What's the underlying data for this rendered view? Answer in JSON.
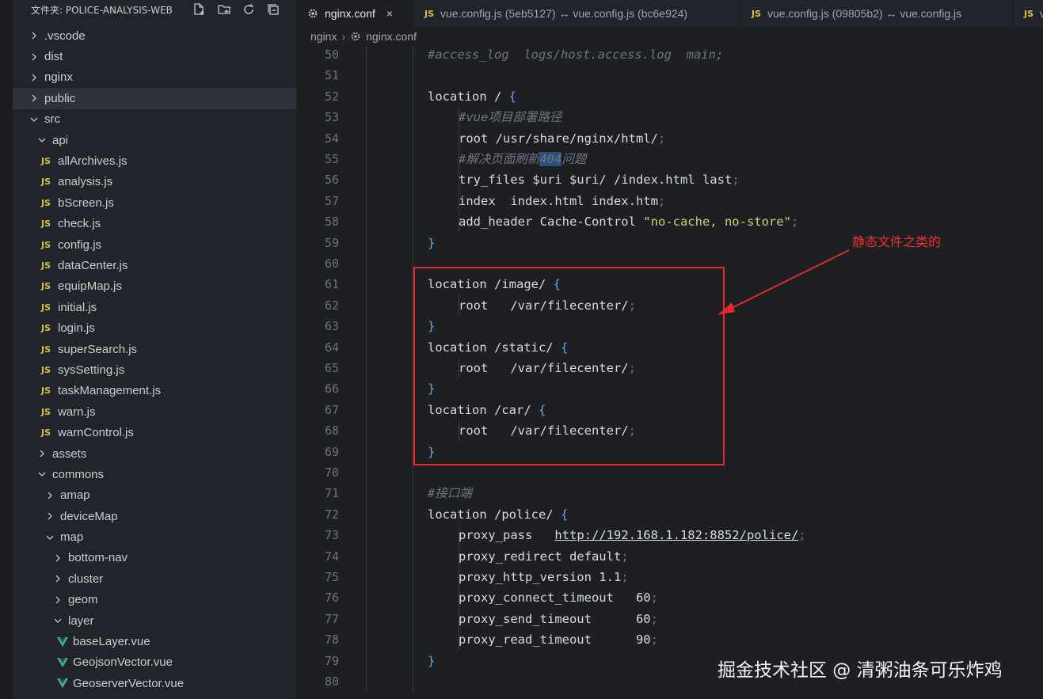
{
  "explorer": {
    "title": "文件夹: POLICE-ANALYSIS-WEB",
    "icons": [
      "new-file-icon",
      "new-folder-icon",
      "refresh-icon",
      "collapse-all-icon"
    ]
  },
  "tree": [
    {
      "label": ".vscode",
      "kind": "folder",
      "expanded": false,
      "depth": 0
    },
    {
      "label": "dist",
      "kind": "folder",
      "expanded": false,
      "depth": 0
    },
    {
      "label": "nginx",
      "kind": "folder",
      "expanded": false,
      "depth": 0
    },
    {
      "label": "public",
      "kind": "folder",
      "expanded": false,
      "depth": 0,
      "selected": true
    },
    {
      "label": "src",
      "kind": "folder",
      "expanded": true,
      "depth": 0
    },
    {
      "label": "api",
      "kind": "folder",
      "expanded": true,
      "depth": 1
    },
    {
      "label": "allArchives.js",
      "kind": "js",
      "depth": 2
    },
    {
      "label": "analysis.js",
      "kind": "js",
      "depth": 2
    },
    {
      "label": "bScreen.js",
      "kind": "js",
      "depth": 2
    },
    {
      "label": "check.js",
      "kind": "js",
      "depth": 2
    },
    {
      "label": "config.js",
      "kind": "js",
      "depth": 2
    },
    {
      "label": "dataCenter.js",
      "kind": "js",
      "depth": 2
    },
    {
      "label": "equipMap.js",
      "kind": "js",
      "depth": 2
    },
    {
      "label": "initial.js",
      "kind": "js",
      "depth": 2
    },
    {
      "label": "login.js",
      "kind": "js",
      "depth": 2
    },
    {
      "label": "superSearch.js",
      "kind": "js",
      "depth": 2
    },
    {
      "label": "sysSetting.js",
      "kind": "js",
      "depth": 2
    },
    {
      "label": "taskManagement.js",
      "kind": "js",
      "depth": 2
    },
    {
      "label": "warn.js",
      "kind": "js",
      "depth": 2
    },
    {
      "label": "warnControl.js",
      "kind": "js",
      "depth": 2
    },
    {
      "label": "assets",
      "kind": "folder",
      "expanded": false,
      "depth": 1
    },
    {
      "label": "commons",
      "kind": "folder",
      "expanded": true,
      "depth": 1
    },
    {
      "label": "amap",
      "kind": "folder",
      "expanded": false,
      "depth": 2
    },
    {
      "label": "deviceMap",
      "kind": "folder",
      "expanded": false,
      "depth": 2
    },
    {
      "label": "map",
      "kind": "folder",
      "expanded": true,
      "depth": 2
    },
    {
      "label": "bottom-nav",
      "kind": "folder",
      "expanded": false,
      "depth": 3
    },
    {
      "label": "cluster",
      "kind": "folder",
      "expanded": false,
      "depth": 3
    },
    {
      "label": "geom",
      "kind": "folder",
      "expanded": false,
      "depth": 3
    },
    {
      "label": "layer",
      "kind": "folder",
      "expanded": true,
      "depth": 3
    },
    {
      "label": "baseLayer.vue",
      "kind": "vue",
      "depth": 4
    },
    {
      "label": "GeojsonVector.vue",
      "kind": "vue",
      "depth": 4
    },
    {
      "label": "GeoserverVector.vue",
      "kind": "vue",
      "depth": 4
    }
  ],
  "tabs": [
    {
      "label": "nginx.conf",
      "icon": "gear-icon",
      "active": true,
      "close": "×"
    },
    {
      "label": "vue.config.js (5eb5127) ↔ vue.config.js (bc6e924)",
      "icon": "js-icon",
      "js": "JS"
    },
    {
      "label": "vue.config.js (09805b2) ↔ vue.config.js",
      "icon": "js-icon",
      "js": "JS"
    },
    {
      "label": "v",
      "icon": "js-icon",
      "js": "JS"
    }
  ],
  "breadcrumb": {
    "folder": "nginx",
    "separator": "›",
    "file": "nginx.conf"
  },
  "code_lines": [
    {
      "n": "50",
      "indent": 1,
      "parts": [
        [
          "cm",
          "#access_log  logs/host.access.log  main;"
        ]
      ]
    },
    {
      "n": "51",
      "indent": 0,
      "parts": []
    },
    {
      "n": "52",
      "indent": 1,
      "parts": [
        [
          "kw",
          "location / "
        ],
        [
          "br",
          "{"
        ]
      ]
    },
    {
      "n": "53",
      "indent": 2,
      "parts": [
        [
          "cm",
          "#vue项目部署路径"
        ]
      ]
    },
    {
      "n": "54",
      "indent": 2,
      "parts": [
        [
          "kw",
          "root /usr/share/nginx/html/"
        ],
        [
          "semi",
          ";"
        ]
      ]
    },
    {
      "n": "55",
      "indent": 2,
      "parts": [
        [
          "cm",
          "#解决页面刷新"
        ],
        [
          "cmhl",
          "404"
        ],
        [
          "cm",
          "问题"
        ]
      ]
    },
    {
      "n": "56",
      "indent": 2,
      "parts": [
        [
          "kw",
          "try_files $uri $uri/ /index.html last"
        ],
        [
          "semi",
          ";"
        ]
      ]
    },
    {
      "n": "57",
      "indent": 2,
      "parts": [
        [
          "kw",
          "index  index.html index.htm"
        ],
        [
          "semi",
          ";"
        ]
      ]
    },
    {
      "n": "58",
      "indent": 2,
      "parts": [
        [
          "kw",
          "add_header Cache-Control "
        ],
        [
          "str",
          "\"no-cache, no-store\""
        ],
        [
          "semi",
          ";"
        ]
      ]
    },
    {
      "n": "59",
      "indent": 1,
      "parts": [
        [
          "br",
          "}"
        ]
      ]
    },
    {
      "n": "60",
      "indent": 0,
      "parts": []
    },
    {
      "n": "61",
      "indent": 1,
      "parts": [
        [
          "kw",
          "location /image/ "
        ],
        [
          "br",
          "{"
        ]
      ]
    },
    {
      "n": "62",
      "indent": 2,
      "parts": [
        [
          "kw",
          "root   /var/filecenter/"
        ],
        [
          "semi",
          ";"
        ]
      ]
    },
    {
      "n": "63",
      "indent": 1,
      "parts": [
        [
          "br",
          "}"
        ]
      ]
    },
    {
      "n": "64",
      "indent": 1,
      "parts": [
        [
          "kw",
          "location /static/ "
        ],
        [
          "br",
          "{"
        ]
      ]
    },
    {
      "n": "65",
      "indent": 2,
      "parts": [
        [
          "kw",
          "root   /var/filecenter/"
        ],
        [
          "semi",
          ";"
        ]
      ]
    },
    {
      "n": "66",
      "indent": 1,
      "parts": [
        [
          "br",
          "}"
        ]
      ]
    },
    {
      "n": "67",
      "indent": 1,
      "parts": [
        [
          "kw",
          "location /car/ "
        ],
        [
          "br",
          "{"
        ]
      ]
    },
    {
      "n": "68",
      "indent": 2,
      "parts": [
        [
          "kw",
          "root   /var/filecenter/"
        ],
        [
          "semi",
          ";"
        ]
      ]
    },
    {
      "n": "69",
      "indent": 1,
      "parts": [
        [
          "br",
          "}"
        ]
      ]
    },
    {
      "n": "70",
      "indent": 0,
      "parts": []
    },
    {
      "n": "71",
      "indent": 1,
      "parts": [
        [
          "cm",
          "#接口端"
        ]
      ]
    },
    {
      "n": "72",
      "indent": 1,
      "parts": [
        [
          "kw",
          "location /police/ "
        ],
        [
          "br",
          "{"
        ]
      ]
    },
    {
      "n": "73",
      "indent": 2,
      "parts": [
        [
          "kw",
          "proxy_pass   "
        ],
        [
          "url",
          "http://192.168.1.182:8852/police/"
        ],
        [
          "semi",
          ";"
        ]
      ]
    },
    {
      "n": "74",
      "indent": 2,
      "parts": [
        [
          "kw",
          "proxy_redirect default"
        ],
        [
          "semi",
          ";"
        ]
      ]
    },
    {
      "n": "75",
      "indent": 2,
      "parts": [
        [
          "kw",
          "proxy_http_version 1.1"
        ],
        [
          "semi",
          ";"
        ]
      ]
    },
    {
      "n": "76",
      "indent": 2,
      "parts": [
        [
          "kw",
          "proxy_connect_timeout   60"
        ],
        [
          "semi",
          ";"
        ]
      ]
    },
    {
      "n": "77",
      "indent": 2,
      "parts": [
        [
          "kw",
          "proxy_send_timeout      60"
        ],
        [
          "semi",
          ";"
        ]
      ]
    },
    {
      "n": "78",
      "indent": 2,
      "parts": [
        [
          "kw",
          "proxy_read_timeout      90"
        ],
        [
          "semi",
          ";"
        ]
      ]
    },
    {
      "n": "79",
      "indent": 1,
      "parts": [
        [
          "br",
          "}"
        ]
      ]
    },
    {
      "n": "80",
      "indent": 0,
      "parts": []
    }
  ],
  "annotation": {
    "text": "静态文件之类的",
    "color": "#e0282e"
  },
  "watermark": "掘金技术社区 @ 清粥油条可乐炸鸡",
  "colors": {
    "background": "#1e1f22",
    "sidebar": "#21252b",
    "js_badge": "#d9c23c",
    "vue_icon": "#41b883",
    "bracket": "#5aa9f5",
    "string": "#c9d37a",
    "comment": "#6f7580"
  }
}
